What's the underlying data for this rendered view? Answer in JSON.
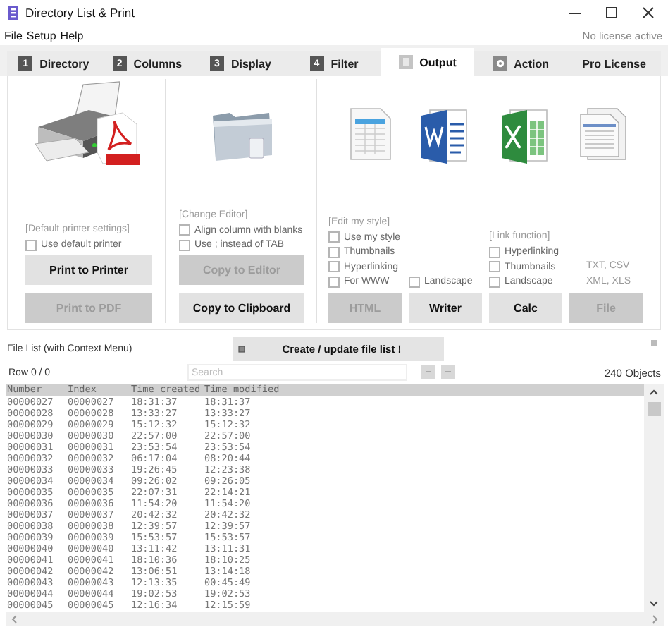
{
  "window": {
    "title": "Directory List & Print"
  },
  "menu": [
    "File",
    "Setup",
    "Help"
  ],
  "license_status": "No license active",
  "tabs": [
    {
      "label": "Directory",
      "kind": "numbered",
      "number": "1",
      "selected": false
    },
    {
      "label": "Columns",
      "kind": "numbered",
      "number": "2",
      "selected": false
    },
    {
      "label": "Display",
      "kind": "numbered",
      "number": "3",
      "selected": false
    },
    {
      "label": "Filter",
      "kind": "numbered",
      "number": "4",
      "selected": false
    },
    {
      "label": "Output",
      "kind": "icon",
      "selected": true
    },
    {
      "label": "Action",
      "kind": "icon",
      "selected": false
    },
    {
      "label": "Pro License",
      "kind": "plain",
      "selected": false
    }
  ],
  "print": {
    "group_label": "[Default printer settings]",
    "options": [
      {
        "label": "Use default printer",
        "checked": false
      }
    ],
    "buttons": [
      {
        "label": "Print to Printer",
        "disabled": false
      },
      {
        "label": "Print to PDF",
        "disabled": true
      }
    ]
  },
  "clipboard": {
    "group_label": "[Change Editor]",
    "options": [
      {
        "label": "Align column with blanks",
        "checked": false
      },
      {
        "label": "Use ; instead of TAB",
        "checked": false
      }
    ],
    "buttons": [
      {
        "label": "Copy to Editor",
        "disabled": true
      },
      {
        "label": "Copy to Clipboard",
        "disabled": false
      }
    ]
  },
  "export": {
    "columns": [
      {
        "group_label": "[Edit my style]",
        "options": [
          {
            "label": "Use my style",
            "checked": false
          },
          {
            "label": "Thumbnails",
            "checked": false
          },
          {
            "label": "Hyperlinking",
            "checked": false
          },
          {
            "label": "For WWW",
            "checked": false
          }
        ],
        "button": {
          "label": "HTML",
          "disabled": true
        }
      },
      {
        "options": [
          {
            "label": "Landscape",
            "checked": false
          }
        ],
        "button": {
          "label": "Writer",
          "disabled": false
        }
      },
      {
        "group_label": "[Link function]",
        "options": [
          {
            "label": "Hyperlinking",
            "checked": false
          },
          {
            "label": "Thumbnails",
            "checked": false
          },
          {
            "label": "Landscape",
            "checked": false
          }
        ],
        "button": {
          "label": "Calc",
          "disabled": false
        }
      },
      {
        "notes": [
          "TXT, CSV",
          "XML, XLS"
        ],
        "button": {
          "label": "File",
          "disabled": true
        }
      }
    ]
  },
  "file_list": {
    "label": "File List (with Context Menu)",
    "create_button": "Create / update file list !",
    "row_status": "Row 0 / 0",
    "search": {
      "placeholder": "Search"
    },
    "object_count": "240 Objects",
    "columns": [
      "Number",
      "Index",
      "Time created",
      "Time modified"
    ],
    "rows": [
      [
        "00000027",
        "00000027",
        "18:31:37",
        "18:31:37"
      ],
      [
        "00000028",
        "00000028",
        "13:33:27",
        "13:33:27"
      ],
      [
        "00000029",
        "00000029",
        "15:12:32",
        "15:12:32"
      ],
      [
        "00000030",
        "00000030",
        "22:57:00",
        "22:57:00"
      ],
      [
        "00000031",
        "00000031",
        "23:53:54",
        "23:53:54"
      ],
      [
        "00000032",
        "00000032",
        "06:17:04",
        "08:20:44"
      ],
      [
        "00000033",
        "00000033",
        "19:26:45",
        "12:23:38"
      ],
      [
        "00000034",
        "00000034",
        "09:26:02",
        "09:26:05"
      ],
      [
        "00000035",
        "00000035",
        "22:07:31",
        "22:14:21"
      ],
      [
        "00000036",
        "00000036",
        "11:54:20",
        "11:54:20"
      ],
      [
        "00000037",
        "00000037",
        "20:42:32",
        "20:42:32"
      ],
      [
        "00000038",
        "00000038",
        "12:39:57",
        "12:39:57"
      ],
      [
        "00000039",
        "00000039",
        "15:53:57",
        "15:53:57"
      ],
      [
        "00000040",
        "00000040",
        "13:11:42",
        "13:11:31"
      ],
      [
        "00000041",
        "00000041",
        "18:10:36",
        "18:10:25"
      ],
      [
        "00000042",
        "00000042",
        "13:06:51",
        "13:14:18"
      ],
      [
        "00000043",
        "00000043",
        "12:13:35",
        "00:45:49"
      ],
      [
        "00000044",
        "00000044",
        "19:02:53",
        "19:02:53"
      ],
      [
        "00000045",
        "00000045",
        "12:16:34",
        "12:15:59"
      ]
    ]
  }
}
